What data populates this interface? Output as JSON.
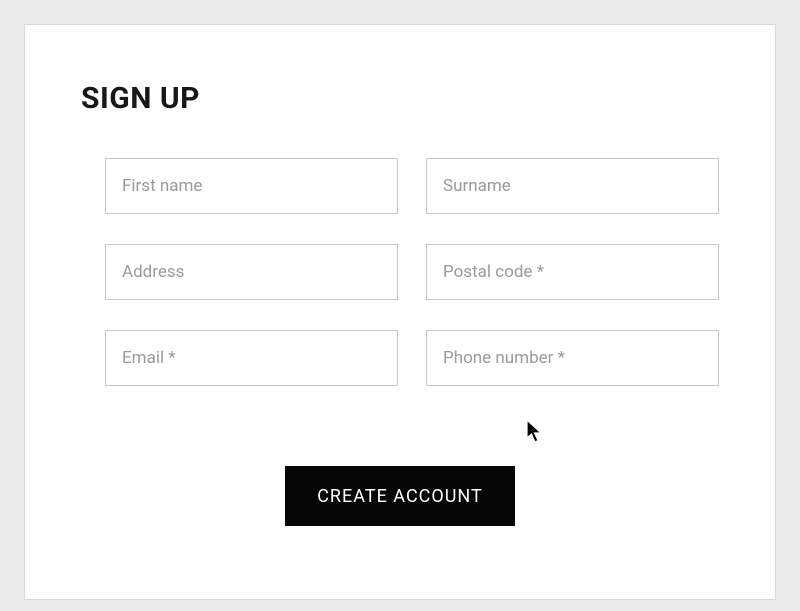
{
  "form": {
    "title": "SIGN UP",
    "fields": {
      "first_name": {
        "placeholder": "First name",
        "value": ""
      },
      "surname": {
        "placeholder": "Surname",
        "value": ""
      },
      "address": {
        "placeholder": "Address",
        "value": ""
      },
      "postal_code": {
        "placeholder": "Postal code *",
        "value": ""
      },
      "email": {
        "placeholder": "Email *",
        "value": ""
      },
      "phone": {
        "placeholder": "Phone number *",
        "value": ""
      }
    },
    "submit_label": "CREATE ACCOUNT"
  }
}
